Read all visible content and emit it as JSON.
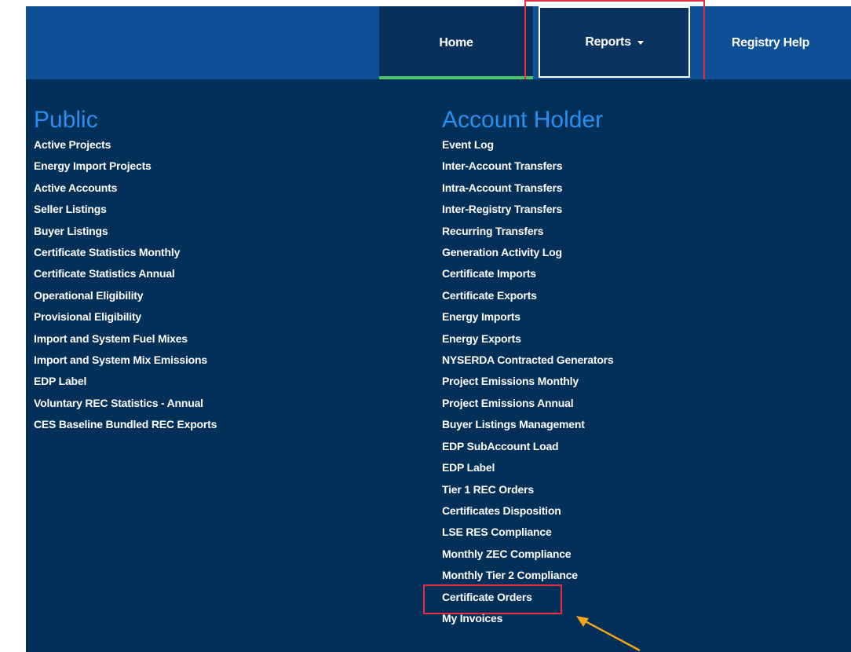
{
  "nav": {
    "home_label": "Home",
    "reports_label": "Reports",
    "help_label": "Registry Help"
  },
  "colors": {
    "nav_bar": "#0e4f96",
    "panel": "#023058",
    "heading": "#2b8ff0",
    "home_underline": "#4fc36a",
    "highlight": "#e23040",
    "arrow": "#f2a516"
  },
  "public": {
    "title": "Public",
    "items": [
      "Active Projects",
      "Energy Import Projects",
      "Active Accounts",
      "Seller Listings",
      "Buyer Listings",
      "Certificate Statistics Monthly",
      "Certificate Statistics Annual",
      "Operational Eligibility",
      "Provisional Eligibility",
      "Import and System Fuel Mixes",
      "Import and System Mix Emissions",
      "EDP Label",
      "Voluntary REC Statistics - Annual",
      "CES Baseline Bundled REC Exports"
    ]
  },
  "account_holder": {
    "title": "Account Holder",
    "items": [
      "Event Log",
      "Inter-Account Transfers",
      "Intra-Account Transfers",
      "Inter-Registry Transfers",
      "Recurring Transfers",
      "Generation Activity Log",
      "Certificate Imports",
      "Certificate Exports",
      "Energy Imports",
      "Energy Exports",
      "NYSERDA Contracted Generators",
      "Project Emissions Monthly",
      "Project Emissions Annual",
      "Buyer Listings Management",
      "EDP SubAccount Load",
      "EDP Label",
      "Tier 1 REC Orders",
      "Certificates Disposition",
      "LSE RES Compliance",
      "Monthly ZEC Compliance",
      "Monthly Tier 2 Compliance",
      "Certificate Orders",
      "My Invoices"
    ]
  }
}
